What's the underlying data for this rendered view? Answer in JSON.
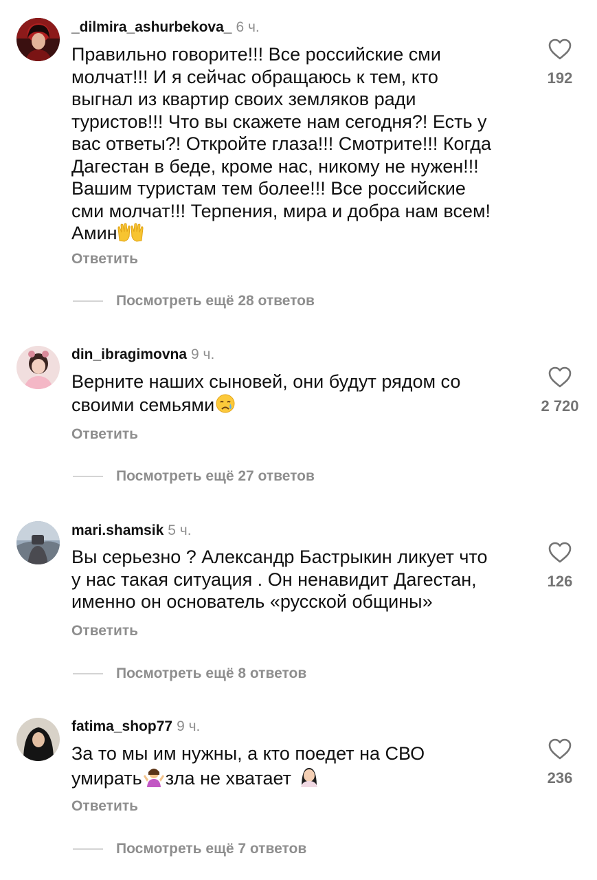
{
  "comments": [
    {
      "username": "_dilmira_ashurbekova_",
      "time": "6 ч.",
      "text": "Правильно говорите!!! Все российские сми\nмолчат!!! И я сейчас обращаюсь к тем, кто\nвыгнал из квартир своих земляков ради\nтуристов!!! Что вы скажете нам сегодня?! Есть у\nвас ответы?! Откройте глаза!!! Смотрите!!! Когда\nДагестан в беде, кроме нас, никому не нужен!!!\nВашим туристам тем более!!! Все российские\nсми молчат!!! Терпения, мира и добра нам всем!\nАмин",
      "emoji": "raising-hands",
      "likes": "192",
      "reply_label": "Ответить",
      "more_replies": "Посмотреть ещё 28 ответов"
    },
    {
      "username": "din_ibragimovna",
      "time": "9 ч.",
      "text": "Верните наших сыновей, они будут рядом со\nсвоими семьями",
      "emoji": "crying-face",
      "likes": "2 720",
      "reply_label": "Ответить",
      "more_replies": "Посмотреть ещё 27 ответов"
    },
    {
      "username": "mari.shamsik",
      "time": "5 ч.",
      "text": "Вы серьезно ? Александр Бастрыкин ликует что\nу нас такая ситуация . Он ненавидит Дагестан,\nименно он основатель «русской общины»",
      "likes": "126",
      "reply_label": "Ответить",
      "more_replies": "Посмотреть ещё 8 ответов"
    },
    {
      "username": "fatima_shop77",
      "time": "9 ч.",
      "text_line1": "За то мы им нужны, а кто поедет на СВО",
      "text_line2a": "умирать",
      "text_line2b": "зла не хватает ",
      "emoji_a": "person-shrugging",
      "emoji_b": "face-palm",
      "likes": "236",
      "reply_label": "Ответить",
      "more_replies": "Посмотреть ещё 7 ответов"
    }
  ],
  "colors": {
    "text": "#111111",
    "secondary": "#8e8e8e",
    "count": "#737373",
    "divider": "#d4d4d4"
  },
  "icons": {
    "like": "heart-outline-icon"
  }
}
